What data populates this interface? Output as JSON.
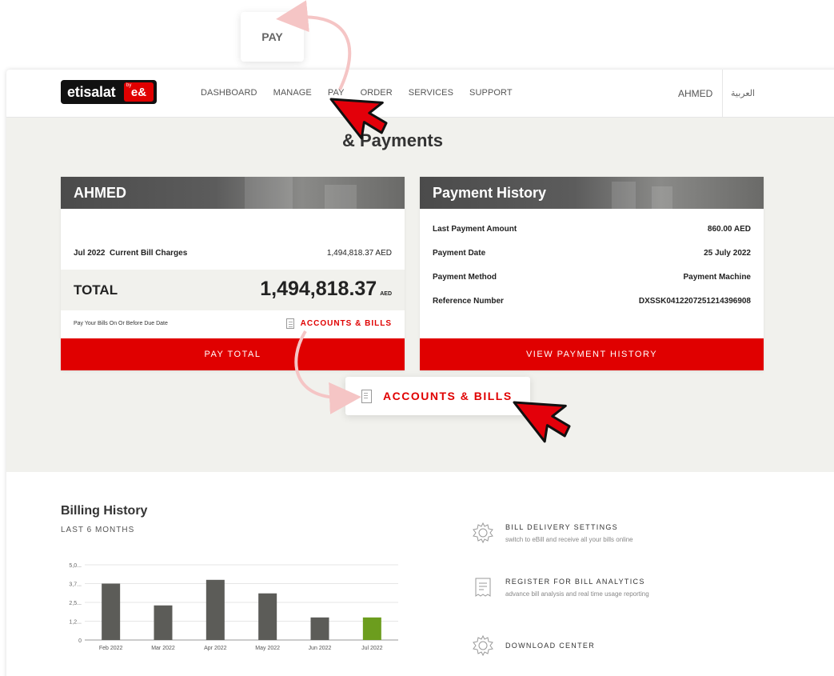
{
  "callouts": {
    "pay": "PAY",
    "accounts_bills": "ACCOUNTS & BILLS"
  },
  "nav": {
    "logo_text": "etisalat",
    "logo_by": "by",
    "logo_badge": "e&",
    "items": [
      {
        "label": "DASHBOARD"
      },
      {
        "label": "MANAGE"
      },
      {
        "label": "PAY"
      },
      {
        "label": "ORDER"
      },
      {
        "label": "SERVICES"
      },
      {
        "label": "SUPPORT"
      }
    ],
    "user": "AHMED",
    "language": "العربية"
  },
  "page": {
    "title": "& Payments"
  },
  "bill_card": {
    "name": "AHMED",
    "period": "Jul 2022",
    "charges_label": "Current Bill Charges",
    "charges_value": "1,494,818.37 AED",
    "total_label": "TOTAL",
    "total_value": "1,494,818.37",
    "total_unit": "AED",
    "due_text": "Pay Your Bills On Or Before Due Date",
    "accounts_link": "ACCOUNTS & BILLS",
    "pay_button": "PAY TOTAL"
  },
  "payment_card": {
    "title": "Payment History",
    "rows": [
      {
        "label": "Last Payment Amount",
        "value": "860.00 AED"
      },
      {
        "label": "Payment Date",
        "value": "25 July 2022"
      },
      {
        "label": "Payment Method",
        "value": "Payment Machine"
      },
      {
        "label": "Reference Number",
        "value": "DXSSK0412207251214396908"
      }
    ],
    "history_button": "VIEW PAYMENT HISTORY"
  },
  "billing_history": {
    "title": "Billing History",
    "subtitle": "LAST 6 MONTHS"
  },
  "chart_data": {
    "type": "bar",
    "categories": [
      "Feb 2022",
      "Mar 2022",
      "Apr 2022",
      "May 2022",
      "Jun 2022",
      "Jul 2022"
    ],
    "values": [
      3.75,
      2.3,
      4.0,
      3.1,
      1.5,
      1.5
    ],
    "y_tick_labels": [
      "0",
      "1,2...",
      "2,5...",
      "3,7...",
      "5,0..."
    ],
    "y_ticks": [
      0,
      1.25,
      2.5,
      3.75,
      5.0
    ],
    "ylim": [
      0,
      5.0
    ],
    "grid": true,
    "bar_color": "#5c5c58",
    "highlight_color": "#6c9d1e",
    "highlight_index": 5
  },
  "options": [
    {
      "icon": "gear-icon",
      "title": "BILL DELIVERY SETTINGS",
      "desc": "switch to eBill and receive all your bills online"
    },
    {
      "icon": "receipt-icon",
      "title": "REGISTER FOR BILL ANALYTICS",
      "desc": "advance bill analysis and real time usage reporting"
    },
    {
      "icon": "gear-icon",
      "title": "DOWNLOAD CENTER",
      "desc": ""
    }
  ],
  "colors": {
    "brand_red": "#e00000",
    "background": "#f1f1ed",
    "dark": "#333333"
  }
}
